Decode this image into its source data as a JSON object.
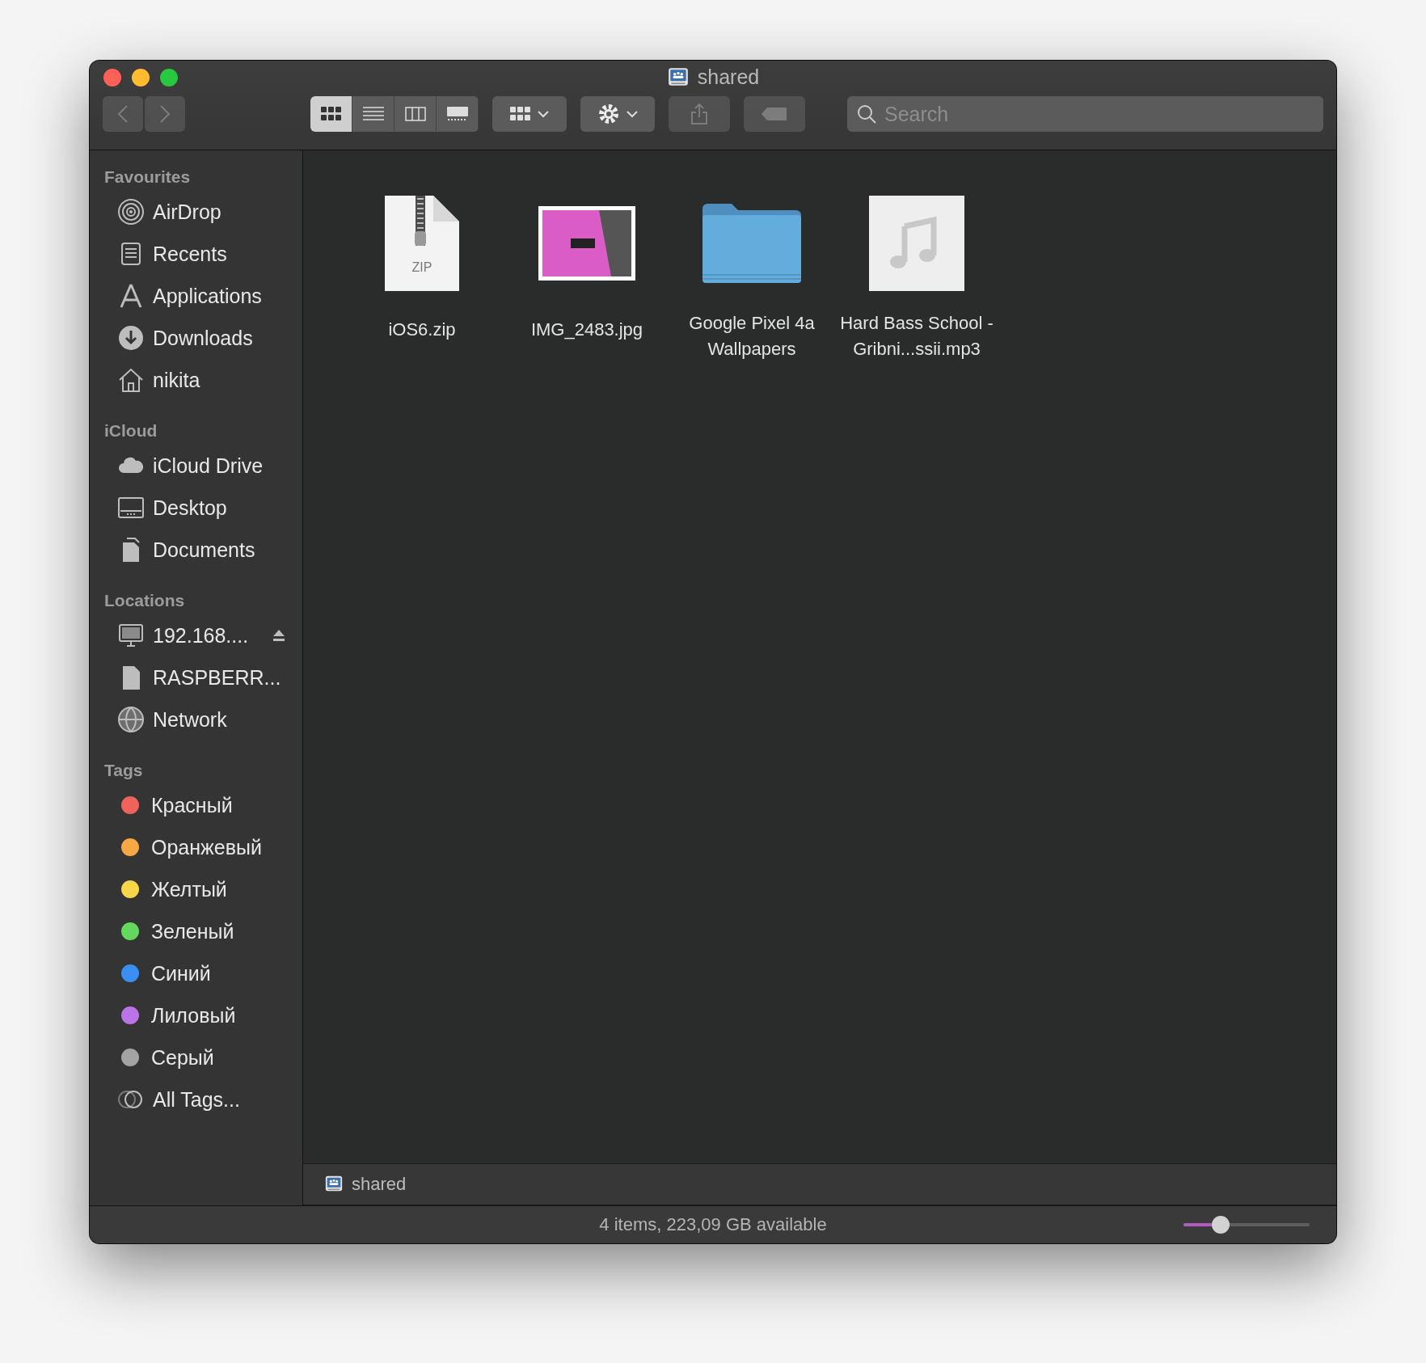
{
  "window": {
    "title": "shared"
  },
  "toolbar": {
    "view_modes": [
      {
        "selected": true
      },
      {
        "selected": false
      },
      {
        "selected": false
      },
      {
        "selected": false
      }
    ],
    "search": {
      "placeholder": "Search"
    }
  },
  "sidebar": {
    "sections": [
      {
        "title": "Favourites",
        "items": [
          {
            "label": "AirDrop"
          },
          {
            "label": "Recents"
          },
          {
            "label": "Applications"
          },
          {
            "label": "Downloads"
          },
          {
            "label": "nikita"
          }
        ]
      },
      {
        "title": "iCloud",
        "items": [
          {
            "label": "iCloud Drive"
          },
          {
            "label": "Desktop"
          },
          {
            "label": "Documents"
          }
        ]
      },
      {
        "title": "Locations",
        "items": [
          {
            "label": "192.168....",
            "ejectable": true
          },
          {
            "label": "RASPBERR...",
            "ejectable": false
          },
          {
            "label": "Network",
            "ejectable": false
          }
        ]
      },
      {
        "title": "Tags",
        "items": [
          {
            "label": "Красный",
            "color": "#f0625c"
          },
          {
            "label": "Оранжевый",
            "color": "#f5a845"
          },
          {
            "label": "Желтый",
            "color": "#f7d648"
          },
          {
            "label": "Зеленый",
            "color": "#64d85d"
          },
          {
            "label": "Синий",
            "color": "#3b8ef3"
          },
          {
            "label": "Лиловый",
            "color": "#bb73e6"
          },
          {
            "label": "Серый",
            "color": "#a3a3a3"
          },
          {
            "label": "All Tags..."
          }
        ]
      }
    ]
  },
  "files": [
    {
      "name": "iOS6.zip",
      "kind": "zip",
      "badge": "ZIP"
    },
    {
      "name": "IMG_2483.jpg",
      "kind": "image"
    },
    {
      "name": "Google Pixel 4a Wallpapers",
      "kind": "folder"
    },
    {
      "name": "Hard Bass School - Gribni...ssii.mp3",
      "kind": "audio"
    }
  ],
  "path_bar": {
    "label": "shared"
  },
  "status_bar": {
    "text": "4 items, 223,09 GB available",
    "zoom": {
      "level": 0.26
    }
  }
}
